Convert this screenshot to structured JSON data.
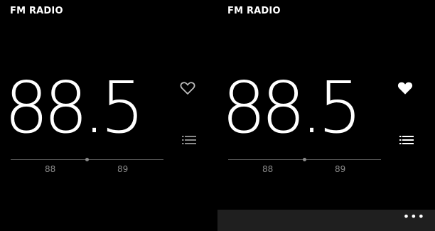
{
  "screens": [
    {
      "app_title": "FM RADIO",
      "frequency": "88.5",
      "favorite": false,
      "tuner": {
        "ticks": [
          "88",
          "89"
        ]
      },
      "icons": {
        "favorite": "heart-outline-icon",
        "stations": "list-icon"
      }
    },
    {
      "app_title": "FM RADIO",
      "frequency": "88.5",
      "favorite": true,
      "tuner": {
        "ticks": [
          "88",
          "89"
        ]
      },
      "icons": {
        "favorite": "heart-filled-icon",
        "stations": "list-icon",
        "more": "ellipsis-icon"
      },
      "app_bar": {
        "more_label": "•••"
      }
    }
  ],
  "colors": {
    "background": "#000000",
    "text": "#ffffff",
    "muted": "#8a8a8a",
    "app_bar": "#1f1f1f"
  }
}
